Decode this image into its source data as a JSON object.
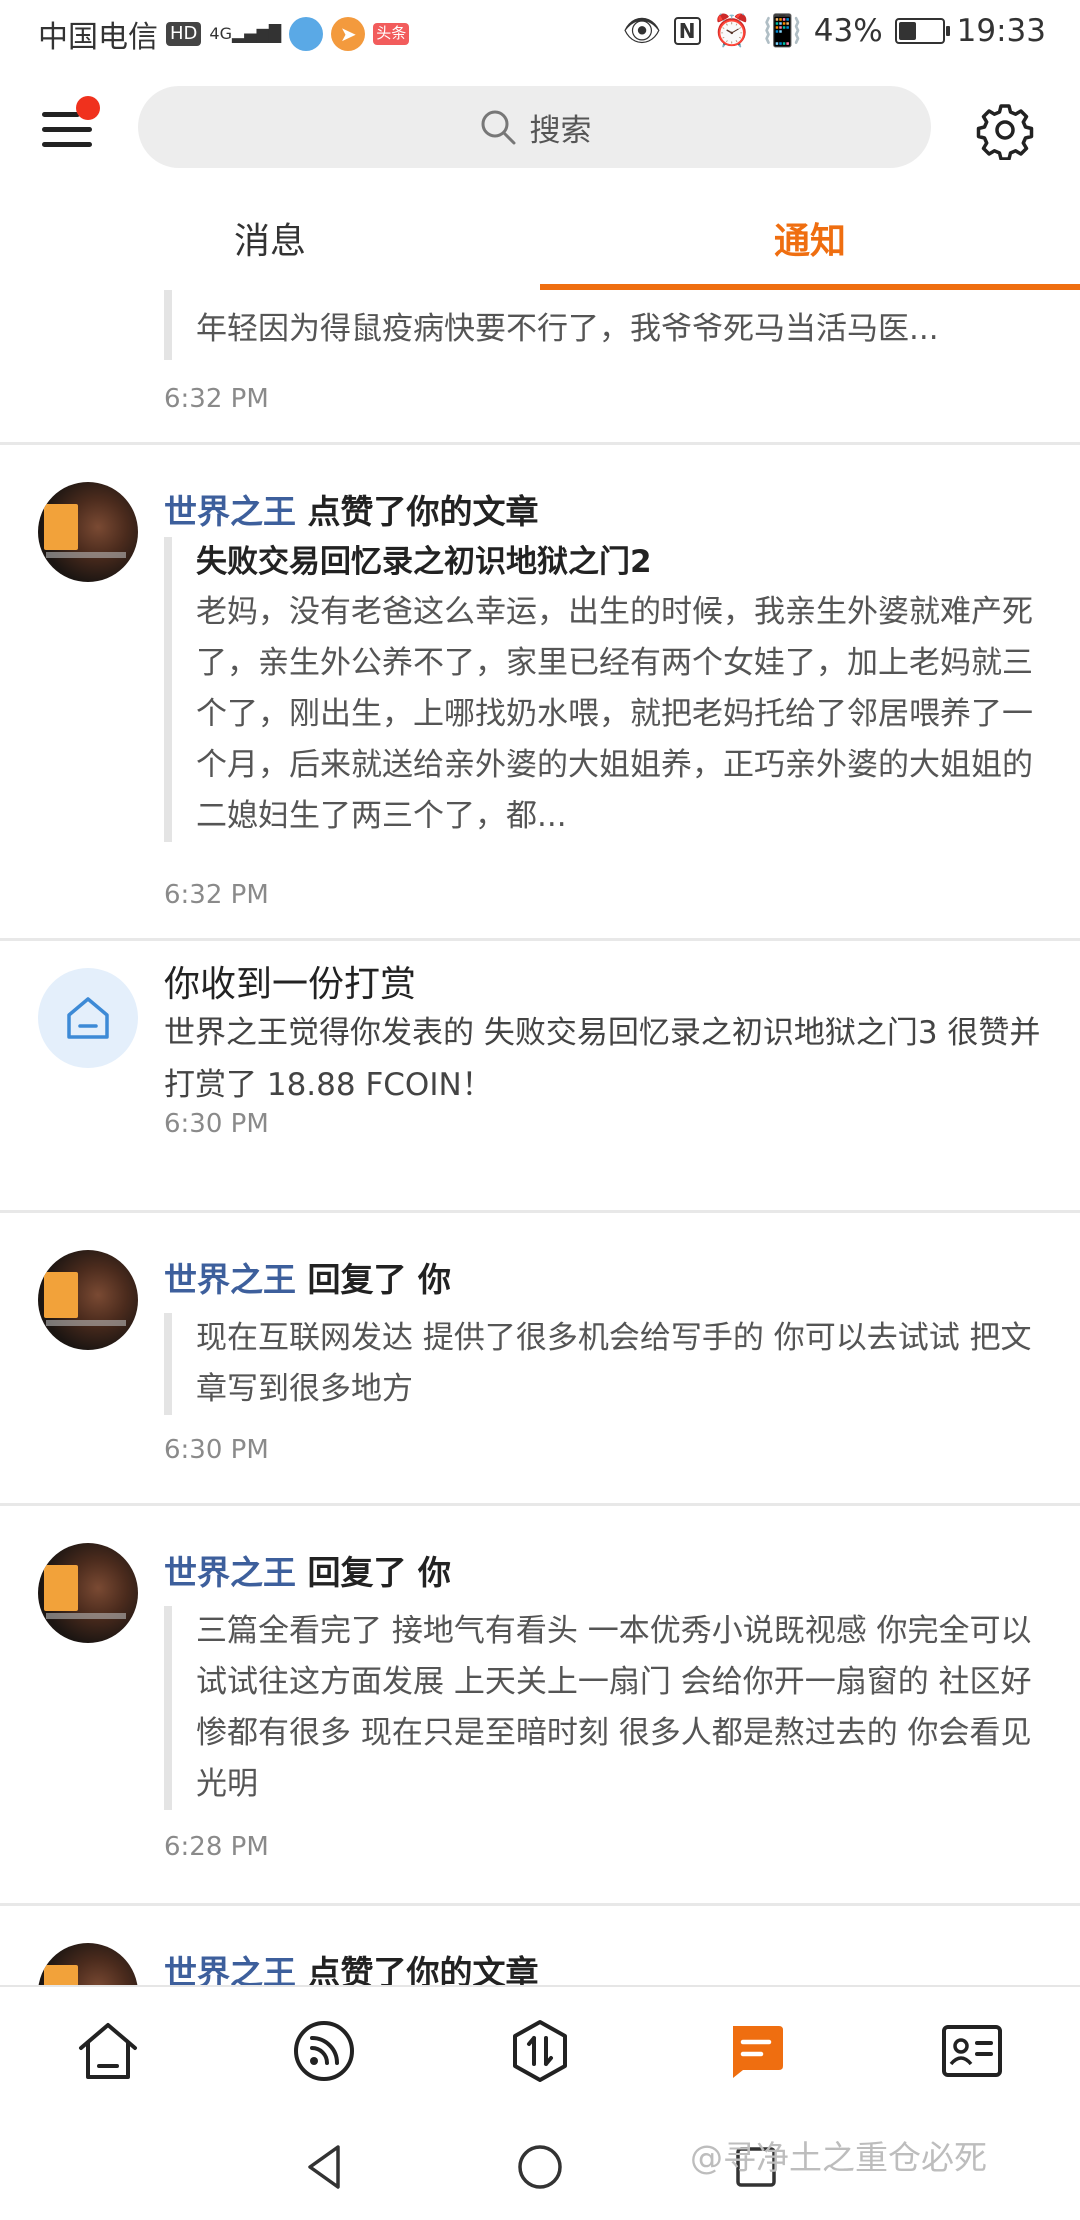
{
  "status_bar": {
    "carrier": "中国电信",
    "hd_badge": "HD",
    "signal_label": "4G",
    "app_badge_3": "头条",
    "battery_percent": "43%",
    "battery_level": 0.43,
    "time": "19:33",
    "icons": [
      "eye-icon",
      "nfc-icon",
      "alarm-icon",
      "vibrate-icon",
      "battery-icon"
    ]
  },
  "header": {
    "search_placeholder": "搜索",
    "has_notification_dot": true,
    "notification_dot_color": "#f0311d"
  },
  "tabs": [
    {
      "label": "消息",
      "active": false
    },
    {
      "label": "通知",
      "active": true
    }
  ],
  "accent_color": "#ef6e10",
  "feed": {
    "item0": {
      "body": "年轻因为得鼠疫病快要不行了，我爷爷死马当活马医...",
      "time": "6:32 PM"
    },
    "item1": {
      "user": "世界之王",
      "action": "点赞了你的文章",
      "quote_title": "失败交易回忆录之初识地狱之门2",
      "quote_body": "老妈，没有老爸这么幸运，出生的时候，我亲生外婆就难产死了，亲生外公养不了，家里已经有两个女娃了，加上老妈就三个了，刚出生，上哪找奶水喂，就把老妈托给了邻居喂养了一个月，后来就送给亲外婆的大姐姐养，正巧亲外婆的大姐姐的二媳妇生了两三个了，都...",
      "time": "6:32 PM"
    },
    "item2": {
      "title": "你收到一份打赏",
      "body": "世界之王觉得你发表的 失败交易回忆录之初识地狱之门3 很赞并打赏了 18.88 FCOIN！",
      "time": "6:30 PM"
    },
    "item3": {
      "user": "世界之王",
      "action": "回复了 你",
      "quote_body": "现在互联网发达 提供了很多机会给写手的 你可以去试试 把文章写到很多地方",
      "time": "6:30 PM"
    },
    "item4": {
      "user": "世界之王",
      "action": "回复了 你",
      "quote_body": "三篇全看完了 接地气有看头 一本优秀小说既视感 你完全可以试试往这方面发展 上天关上一扇门 会给你开一扇窗的 社区好惨都有很多 现在只是至暗时刻 很多人都是熬过去的 你会看见光明",
      "time": "6:28 PM"
    },
    "item5": {
      "user": "世界之王",
      "action": "点赞了你的文章"
    }
  },
  "bottom_nav": {
    "items": [
      {
        "icon": "home-icon",
        "active": false
      },
      {
        "icon": "feed-icon",
        "active": false
      },
      {
        "icon": "trade-icon",
        "active": false
      },
      {
        "icon": "notification-icon",
        "active": true
      },
      {
        "icon": "profile-card-icon",
        "active": false
      }
    ]
  },
  "system_nav": {
    "watermark": "@寻净土之重仓必死"
  }
}
